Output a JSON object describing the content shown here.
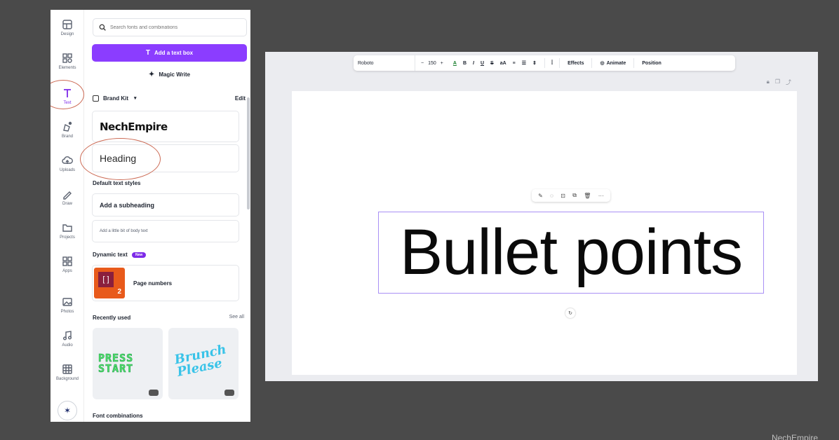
{
  "rail": {
    "items": [
      {
        "label": "Design",
        "icon": "design-icon"
      },
      {
        "label": "Elements",
        "icon": "elements-icon"
      },
      {
        "label": "Text",
        "icon": "text-icon"
      },
      {
        "label": "Brand",
        "icon": "brand-icon"
      },
      {
        "label": "Uploads",
        "icon": "upload-icon"
      },
      {
        "label": "Draw",
        "icon": "draw-icon"
      },
      {
        "label": "Projects",
        "icon": "folder-icon"
      },
      {
        "label": "Apps",
        "icon": "apps-icon"
      },
      {
        "label": "Photos",
        "icon": "photos-icon"
      },
      {
        "label": "Audio",
        "icon": "audio-icon"
      },
      {
        "label": "Background",
        "icon": "background-icon"
      }
    ],
    "active": "Text"
  },
  "text_panel": {
    "search_placeholder": "Search fonts and combinations",
    "add_text_box": "Add a text box",
    "magic_write": "Magic Write",
    "brand_kit": "Brand Kit",
    "edit": "Edit",
    "brand_logo": "NechEmpire",
    "heading": "Heading",
    "default_styles_title": "Default text styles",
    "subheading": "Add a subheading",
    "body_text": "Add a little bit of body text",
    "dynamic_text_title": "Dynamic text",
    "new_badge": "New",
    "page_numbers": "Page numbers",
    "page_number_digit": "2",
    "recently_used": "Recently used",
    "see_all": "See all",
    "recent_fonts": [
      "PRESS START",
      "Brunch Please"
    ],
    "font_combinations": "Font combinations"
  },
  "editor": {
    "toolbar": {
      "font": "Roboto",
      "size": "150",
      "effects": "Effects",
      "animate": "Animate",
      "position": "Position"
    },
    "canvas_text": "Bullet points"
  },
  "watermark": "NechEmpire",
  "colors": {
    "accent": "#8b3dff",
    "selection": "#a990f5",
    "annotation": "#cc6b55"
  }
}
